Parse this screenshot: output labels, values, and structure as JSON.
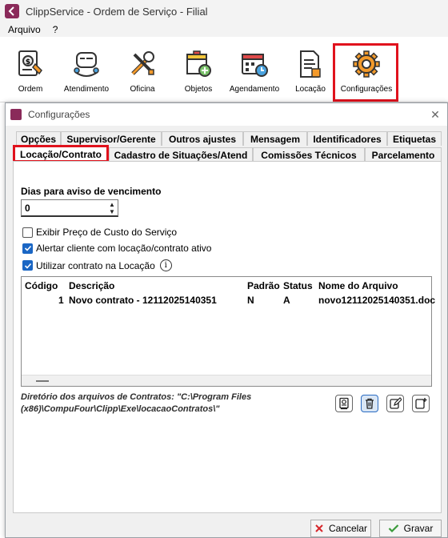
{
  "window": {
    "title": "ClippService - Ordem de Serviço - Filial"
  },
  "menu": {
    "items": [
      "Arquivo",
      "?"
    ]
  },
  "toolbar": {
    "buttons": [
      {
        "label": "Ordem",
        "icon": "ordem-icon"
      },
      {
        "label": "Atendimento",
        "icon": "headset-icon"
      },
      {
        "label": "Oficina",
        "icon": "tools-icon"
      },
      {
        "label": "Objetos",
        "icon": "box-icon"
      },
      {
        "label": "Agendamento",
        "icon": "calendar-icon"
      },
      {
        "label": "Locação",
        "icon": "document-icon"
      },
      {
        "label": "Configurações",
        "icon": "gear-icon"
      }
    ]
  },
  "dialog": {
    "title": "Configurações",
    "tabs_row1": [
      "Opções",
      "Supervisor/Gerente",
      "Outros ajustes",
      "Mensagem",
      "Identificadores",
      "Etiquetas"
    ],
    "tabs_row2": [
      "Locação/Contrato",
      "Cadastro de Situações/Atend",
      "Comissões Técnicos",
      "Parcelamento"
    ],
    "active_tab": "Locação/Contrato",
    "dias_label": "Dias para aviso de vencimento",
    "dias_value": "0",
    "checkboxes": [
      {
        "label": "Exibir Preço de Custo do Serviço",
        "checked": false
      },
      {
        "label": "Alertar cliente com locação/contrato ativo",
        "checked": true
      },
      {
        "label": "Utilizar contrato na Locação",
        "checked": true
      }
    ],
    "table": {
      "columns": [
        "Código",
        "Descrição",
        "Padrão",
        "Status",
        "Nome do Arquivo"
      ],
      "rows": [
        [
          "1",
          "Novo contrato - 12112025140351",
          "N",
          "A",
          "novo12112025140351.doc"
        ]
      ]
    },
    "directory_text": "Diretório dos arquivos de Contratos: \"C:\\Program Files (x86)\\CompuFour\\Clipp\\Exe\\locacaoContratos\\\"",
    "buttons": {
      "cancel": "Cancelar",
      "save": "Gravar"
    }
  },
  "colors": {
    "highlight": "#e0121d",
    "accent": "#1a66c4",
    "logo": "#8a2a5a"
  }
}
